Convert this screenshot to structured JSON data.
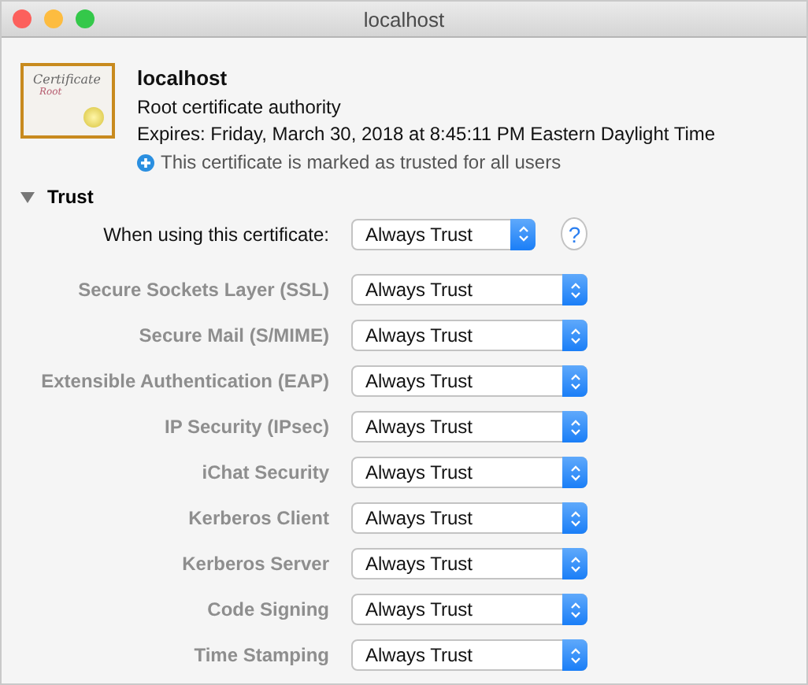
{
  "window": {
    "title": "localhost"
  },
  "certificate": {
    "name": "localhost",
    "kind": "Root certificate authority",
    "expires": "Expires: Friday, March 30, 2018 at 8:45:11 PM Eastern Daylight Time",
    "trust_note": "This certificate is marked as trusted for all users",
    "icon_badge": "Root",
    "icon_title": "Certificate"
  },
  "trust": {
    "label": "Trust",
    "expanded": true,
    "main": {
      "label": "When using this certificate:",
      "value": "Always Trust"
    },
    "help": "?",
    "policies": [
      {
        "label": "Secure Sockets Layer (SSL)",
        "value": "Always Trust",
        "disabled": true
      },
      {
        "label": "Secure Mail (S/MIME)",
        "value": "Always Trust",
        "disabled": true
      },
      {
        "label": "Extensible Authentication (EAP)",
        "value": "Always Trust",
        "disabled": true
      },
      {
        "label": "IP Security (IPsec)",
        "value": "Always Trust",
        "disabled": true
      },
      {
        "label": "iChat Security",
        "value": "Always Trust",
        "disabled": true
      },
      {
        "label": "Kerberos Client",
        "value": "Always Trust",
        "disabled": true
      },
      {
        "label": "Kerberos Server",
        "value": "Always Trust",
        "disabled": true
      },
      {
        "label": "Code Signing",
        "value": "Always Trust",
        "disabled": true
      },
      {
        "label": "Time Stamping",
        "value": "Always Trust",
        "disabled": true
      }
    ]
  }
}
